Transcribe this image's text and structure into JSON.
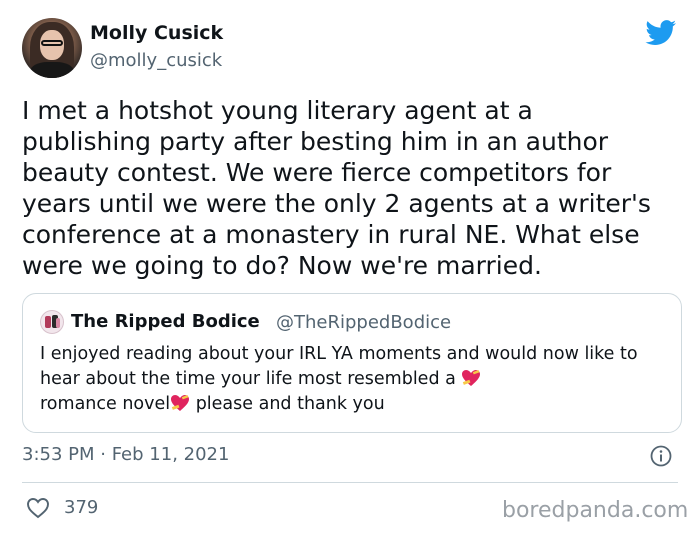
{
  "author": {
    "name": "Molly Cusick",
    "handle": "@molly_cusick"
  },
  "tweet": {
    "text": "I met a hotshot young literary agent at a\npublishing party after besting him in an author\nbeauty contest. We were fierce competitors for\nyears until we were the only 2 agents at a writer's\nconference at a monastery in rural NE. What else\nwere we going to do? Now we're married."
  },
  "quoted_tweet": {
    "name": "The Ripped Bodice",
    "handle": "@TheRippedBodice",
    "text_part1": "I enjoyed reading about your IRL YA  moments and would now like to hear about the time your life most resembled a ",
    "text_part2": "romance novel",
    "text_part3": " please and thank you"
  },
  "timestamp": "3:53 PM · Feb 11, 2021",
  "likes": "379",
  "watermark": "boredpanda.com",
  "colors": {
    "twitter_blue": "#1d9bf0",
    "secondary_text": "#536471",
    "border": "#cfd9de"
  },
  "icons": {
    "brand": "twitter-bird-icon",
    "info": "info-icon",
    "like": "heart-outline-icon",
    "emoji": "heart-with-ribbon-emoji"
  }
}
